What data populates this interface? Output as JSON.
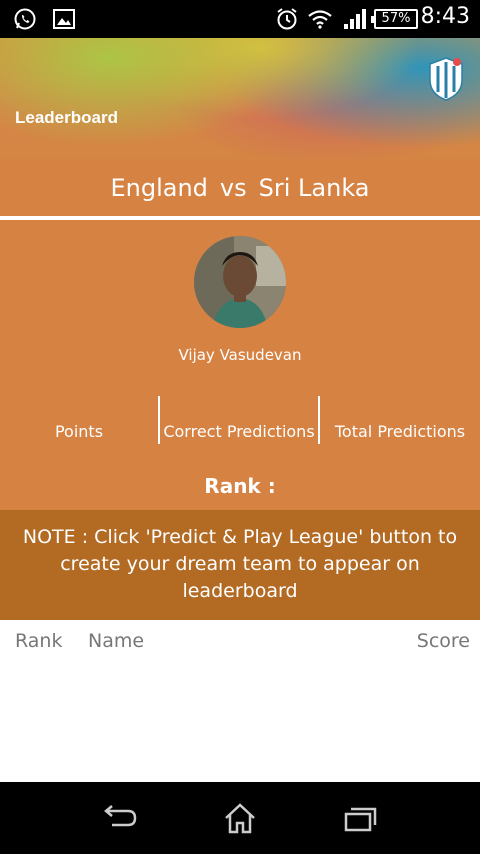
{
  "status_bar": {
    "battery": "57%",
    "time": "8:43",
    "icons": [
      "whatsapp-icon",
      "image-icon",
      "alarm-icon",
      "wifi-icon",
      "signal-icon"
    ]
  },
  "header": {
    "title": "Leaderboard",
    "logo": "team-logo-icon"
  },
  "match": {
    "team1": "England",
    "vs": "vs",
    "team2": "Sri Lanka"
  },
  "profile": {
    "name": "Vijay Vasudevan",
    "stats": {
      "points": "Points",
      "correct": "Correct Predictions",
      "total": "Total Predictions"
    },
    "rank": "Rank :"
  },
  "note": "NOTE : Click 'Predict & Play League' button to create your dream team to appear on leaderboard",
  "table": {
    "headers": {
      "rank": "Rank",
      "name": "Name",
      "score": "Score"
    }
  },
  "colors": {
    "primary": "#d58243",
    "note_bg": "#b36a23",
    "header_text": "#ffffff",
    "table_header": "#777777"
  },
  "nav_bar": {
    "buttons": [
      "back-icon",
      "home-icon",
      "recents-icon"
    ]
  }
}
